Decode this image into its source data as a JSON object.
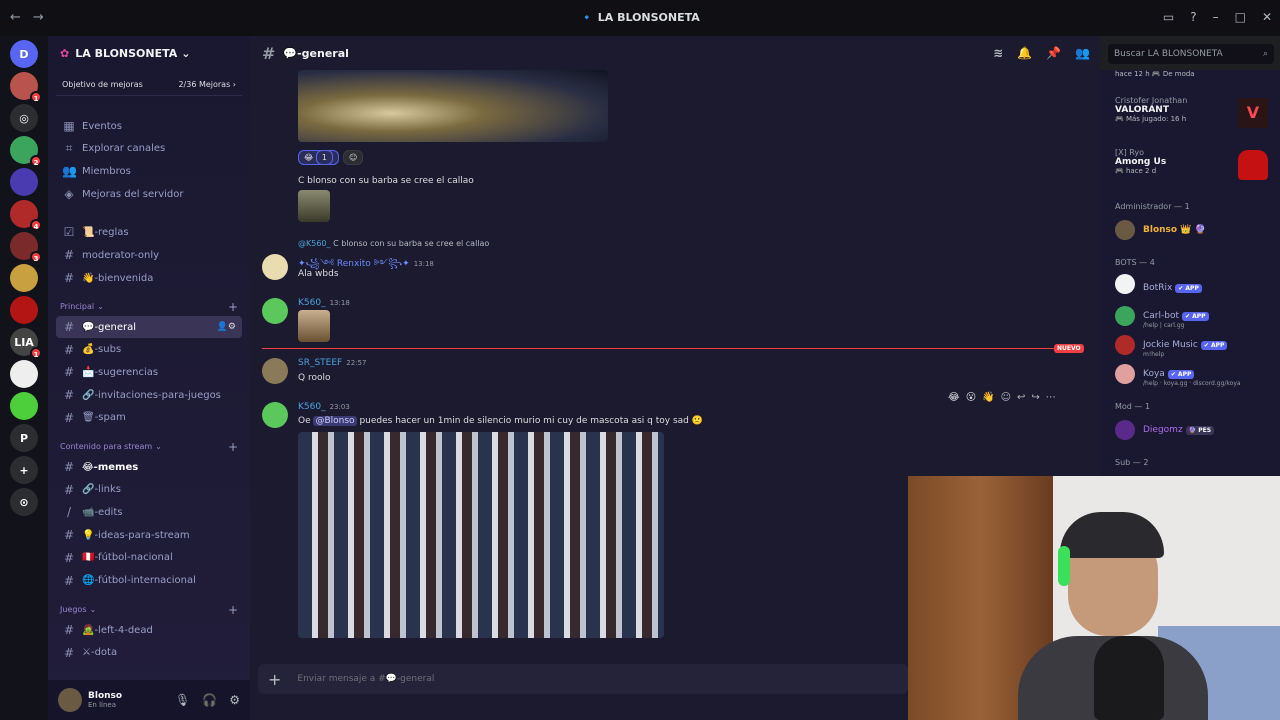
{
  "window": {
    "title": "LA BLONSONETA"
  },
  "server": {
    "name": "LA BLONSONETA",
    "boost_label": "Objetivo de mejoras",
    "boost_progress": "2/36 Mejoras"
  },
  "servers_list": [
    {
      "color": "#5865f2",
      "label": "D"
    },
    {
      "color": "#b9534d",
      "label": "",
      "badge": "1"
    },
    {
      "color": "#2b2d31",
      "label": "◎"
    },
    {
      "color": "#3ba55d",
      "label": "",
      "badge": "2"
    },
    {
      "color": "#4a3bb0",
      "label": ""
    },
    {
      "color": "#b02a2a",
      "label": "",
      "badge": "4"
    },
    {
      "color": "#7a2a2a",
      "label": "",
      "badge": "3"
    },
    {
      "color": "#c8a040",
      "label": ""
    },
    {
      "color": "#b31414",
      "label": ""
    },
    {
      "color": "#444444",
      "label": "LIA",
      "badge": "1"
    },
    {
      "color": "#eeeeee",
      "label": ""
    },
    {
      "color": "#4ccf3a",
      "label": ""
    },
    {
      "color": "#2b2d31",
      "label": "P"
    },
    {
      "color": "#2b2d31",
      "label": "+"
    },
    {
      "color": "#2b2d31",
      "label": "⊙"
    }
  ],
  "nav": [
    {
      "label": "Eventos",
      "icon": "▦"
    },
    {
      "label": "Explorar canales",
      "icon": "⌗"
    },
    {
      "label": "Miembros",
      "icon": "👥"
    },
    {
      "label": "Mejoras del servidor",
      "icon": "◈"
    }
  ],
  "channels_top": [
    {
      "label": "📜-reglas",
      "icon": "☑"
    },
    {
      "label": "moderator-only",
      "icon": "#"
    },
    {
      "label": "👋-bienvenida",
      "icon": "#"
    }
  ],
  "cat_principal": "Principal",
  "channels_principal": [
    {
      "label": "💬-general",
      "icon": "#",
      "active": true
    },
    {
      "label": "💰-subs",
      "icon": "#"
    },
    {
      "label": "📩-sugerencias",
      "icon": "#"
    },
    {
      "label": "🔗-invitaciones-para-juegos",
      "icon": "#"
    },
    {
      "label": "🗑-spam",
      "icon": "#"
    }
  ],
  "cat_stream": "Contenido para stream",
  "channels_stream": [
    {
      "label": "😂-memes",
      "icon": "#",
      "bold": true
    },
    {
      "label": "🔗-links",
      "icon": "#"
    },
    {
      "label": "📹-edits",
      "icon": "/"
    },
    {
      "label": "💡-ideas-para-stream",
      "icon": "#"
    },
    {
      "label": "🇵🇪-fútbol-nacional",
      "icon": "#"
    },
    {
      "label": "🌐-fútbol-internacional",
      "icon": "#"
    }
  ],
  "cat_juegos": "Juegos",
  "channels_juegos": [
    {
      "label": "🧟-left-4-dead",
      "icon": "#"
    },
    {
      "label": "⚔-dota",
      "icon": "#"
    }
  ],
  "user": {
    "name": "Blonso",
    "status": "En línea"
  },
  "chat": {
    "channel": "💬-general",
    "placeholder": "Enviar mensaje a #💬-general",
    "reaction_count": "1",
    "new_label": "NUEVO",
    "messages": {
      "m1_text": "C blonso con su barba se cree el callao",
      "reply_preview_user": "@K560_",
      "reply_preview_text": "C blonso con su barba se cree el callao",
      "m2_user": "✦꧁༺ Renxito ༻꧂✦",
      "m2_time": "13:18",
      "m2_text": "Ala wbds",
      "m3_user": "K560_",
      "m3_time": "13:18",
      "m4_user": "SR_STEEF",
      "m4_time": "22:57",
      "m4_text": "Q roolo",
      "m5_user": "K560_",
      "m5_time": "23:03",
      "m5_pre": "Oe ",
      "m5_mention": "@Blonso",
      "m5_post": " puedes hacer un 1min de silencio murio mi cuy de mascota asi q toy sad 🙁"
    }
  },
  "search": {
    "placeholder": "Buscar LA BLONSONETA"
  },
  "members": {
    "top_activity": "hace 12 h  🎮 De moda",
    "act1_who": "Cristofer Jonathan",
    "act1_game": "VALORANT",
    "act1_when": "🎮 Más jugado: 16 h",
    "act2_who": "[X] Ryo",
    "act2_game": "Among Us",
    "act2_when": "🎮 hace 2 d",
    "cat_admin": "Administrador — 1",
    "admin_name": "Blonso 👑 🔮",
    "cat_bots": "BOTS — 4",
    "bots": [
      {
        "name": "BotRix",
        "sub": "",
        "tag": "✔ APP",
        "color": "#f2f3f5"
      },
      {
        "name": "Carl-bot",
        "sub": "/help | carl.gg",
        "tag": "✔ APP",
        "color": "#3ba55d"
      },
      {
        "name": "Jockie Music",
        "sub": "m!help",
        "tag": "✔ APP",
        "color": "#b02a2a"
      },
      {
        "name": "Koya",
        "sub": "/help · koya.gg · discord.gg/koya",
        "tag": "✔ APP",
        "color": "#e0a0a0"
      }
    ],
    "cat_mod": "Mod — 1",
    "mod_name": "Diegomz",
    "mod_tag": "🔮 PES",
    "cat_sub": "Sub — 2"
  }
}
